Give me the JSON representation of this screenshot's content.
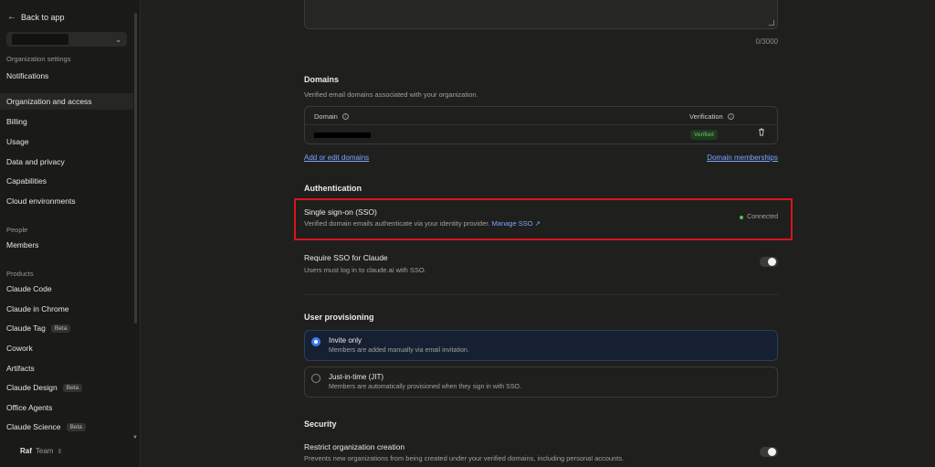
{
  "sidebar": {
    "back_label": "Back to app",
    "org_section_label": "Organization settings",
    "org_items": [
      "Notifications",
      "Organization and access",
      "Billing",
      "Usage",
      "Data and privacy",
      "Capabilities",
      "Cloud environments"
    ],
    "people_label": "People",
    "people_items": [
      "Members"
    ],
    "products_label": "Products",
    "products": [
      {
        "label": "Claude Code",
        "badge": ""
      },
      {
        "label": "Claude in Chrome",
        "badge": ""
      },
      {
        "label": "Claude Tag",
        "badge": "Beta"
      },
      {
        "label": "Cowork",
        "badge": ""
      },
      {
        "label": "Artifacts",
        "badge": ""
      },
      {
        "label": "Claude Design",
        "badge": "Beta"
      },
      {
        "label": "Office Agents",
        "badge": ""
      },
      {
        "label": "Claude Science",
        "badge": "Beta"
      }
    ],
    "user_name": "Raf",
    "user_plan": "Team"
  },
  "main": {
    "char_counter": "0/3000",
    "domains": {
      "title": "Domains",
      "description": "Verified email domains associated with your organization.",
      "col_domain": "Domain",
      "col_verification": "Verification",
      "status_badge": "Verified",
      "add_link": "Add or edit domains",
      "memberships_link": "Domain memberships"
    },
    "authentication": {
      "title": "Authentication",
      "sso_title": "Single sign-on (SSO)",
      "sso_desc": "Verified domain emails authenticate via your identity provider.",
      "manage_sso": "Manage SSO",
      "sso_status": "Connected",
      "require_title": "Require SSO for Claude",
      "require_desc": "Users must log in to claude.ai with SSO."
    },
    "provisioning": {
      "title": "User provisioning",
      "options": [
        {
          "title": "Invite only",
          "desc": "Members are added manually via email invitation.",
          "selected": true
        },
        {
          "title": "Just-in-time (JIT)",
          "desc": "Members are automatically provisioned when they sign in with SSO.",
          "selected": false
        }
      ]
    },
    "security": {
      "title": "Security",
      "restrict_title": "Restrict organization creation",
      "restrict_desc": "Prevents new organizations from being created under your verified domains, including personal accounts."
    }
  },
  "colors": {
    "accent": "#3d7bf2",
    "link": "#7aa7ff",
    "highlight_border": "#d8141d",
    "connected": "#4fc24f"
  }
}
